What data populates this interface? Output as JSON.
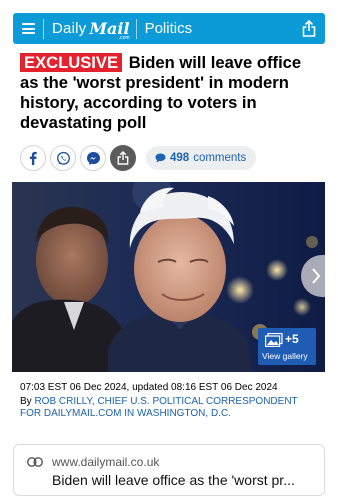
{
  "header": {
    "logo_daily": "Daily",
    "logo_mail": "Mail",
    "logo_com": ".com",
    "section": "Politics",
    "bar_color": "#0c9bd6"
  },
  "article": {
    "tag": "EXCLUSIVE",
    "headline": "Biden will leave office as the 'worst president' in modern history, according to voters in devastating poll",
    "share_icons": [
      "facebook-icon",
      "whatsapp-icon",
      "messenger-icon",
      "share-icon"
    ],
    "comments_count": "498",
    "comments_label": "comments",
    "gallery_count": "+5",
    "gallery_label": "View gallery",
    "dateline": "07:03 EST 06 Dec 2024, updated 08:16 EST 06 Dec 2024",
    "by_prefix": "By",
    "author": "Rob Crilly, Chief U.s. Political Correspondent For Dailymail.com In Washington, D.c."
  },
  "link_card": {
    "domain": "www.dailymail.co.uk",
    "title": "Biden will leave office as the 'worst pr..."
  },
  "colors": {
    "tag_red": "#e3222e",
    "link_blue": "#1d62b0",
    "gallery_blue": "#1f5db5"
  }
}
